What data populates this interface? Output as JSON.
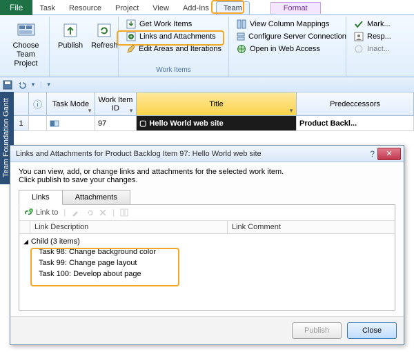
{
  "ribbon": {
    "file": "File",
    "tabs": [
      "Task",
      "Resource",
      "Project",
      "View",
      "Add-Ins",
      "Team"
    ],
    "contextual": "Format"
  },
  "groups": {
    "choose": "Choose\nTeam Project",
    "publish": "Publish",
    "refresh": "Refresh",
    "workitems_label": "Work Items",
    "get_work_items": "Get Work Items",
    "links_attachments": "Links and Attachments",
    "edit_areas": "Edit Areas and Iterations",
    "view_column_mappings": "View Column Mappings",
    "configure_server": "Configure Server Connection",
    "open_web": "Open in Web Access",
    "mark": "Mark...",
    "resp": "Resp...",
    "inact": "Inact..."
  },
  "side_tab": "Team Foundation Gantt",
  "grid": {
    "headers": {
      "info": "ⓘ",
      "task_mode": "Task Mode",
      "work_item_id": "Work Item ID",
      "title": "Title",
      "predecessors": "Predeccessors"
    },
    "row": {
      "num": "1",
      "work_item_id": "97",
      "title": "Hello World web site",
      "predecessors": "Product Backl..."
    }
  },
  "dialog": {
    "title": "Links and Attachments for Product Backlog Item 97: Hello World web site",
    "intro1": "You can view, add, or change links and attachments for the selected work item.",
    "intro2": "Click publish to save your changes.",
    "tabs": {
      "links": "Links",
      "attachments": "Attachments"
    },
    "toolbar": {
      "link_to": "Link to"
    },
    "cols": {
      "desc": "Link Description",
      "comment": "Link Comment"
    },
    "tree": {
      "parent": "Child (3 items)",
      "children": [
        "Task 98: Change background color",
        "Task 99: Change page layout",
        "Task 100: Develop about page"
      ]
    },
    "publish": "Publish",
    "close": "Close"
  }
}
